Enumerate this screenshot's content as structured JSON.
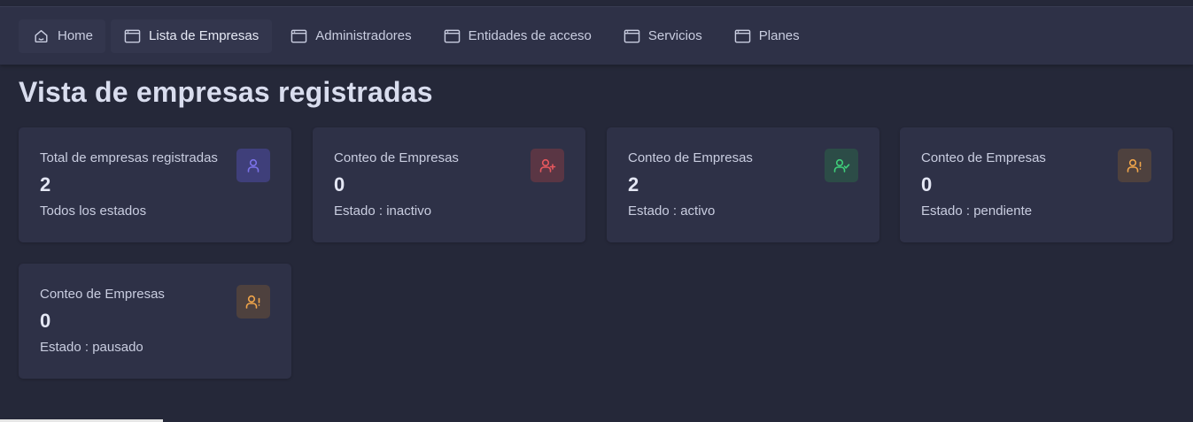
{
  "nav": {
    "items": [
      {
        "label": "Home",
        "icon": "home-icon"
      },
      {
        "label": "Lista de Empresas",
        "icon": "window-icon"
      },
      {
        "label": "Administradores",
        "icon": "window-icon"
      },
      {
        "label": "Entidades de acceso",
        "icon": "window-icon"
      },
      {
        "label": "Servicios",
        "icon": "window-icon"
      },
      {
        "label": "Planes",
        "icon": "window-icon"
      }
    ],
    "active": "Lista de Empresas"
  },
  "page": {
    "title": "Vista de empresas registradas"
  },
  "cards": [
    {
      "label": "Total de empresas registradas",
      "value": "2",
      "sub": "Todos los estados",
      "icon": "user-icon",
      "color": "#7b72e8",
      "bg": "#3f3f7a"
    },
    {
      "label": "Conteo de Empresas",
      "value": "0",
      "sub": "Estado : inactivo",
      "icon": "user-plus-icon",
      "color": "#e8585e",
      "bg": "#5a3644"
    },
    {
      "label": "Conteo de Empresas",
      "value": "2",
      "sub": "Estado : activo",
      "icon": "user-check-icon",
      "color": "#3fcf7a",
      "bg": "#2c4c47"
    },
    {
      "label": "Conteo de Empresas",
      "value": "0",
      "sub": "Estado : pendiente",
      "icon": "user-alert-icon",
      "color": "#f0a54a",
      "bg": "#4e413e"
    },
    {
      "label": "Conteo de Empresas",
      "value": "0",
      "sub": "Estado : pausado",
      "icon": "user-alert-icon",
      "color": "#f0a54a",
      "bg": "#4e413e"
    }
  ]
}
